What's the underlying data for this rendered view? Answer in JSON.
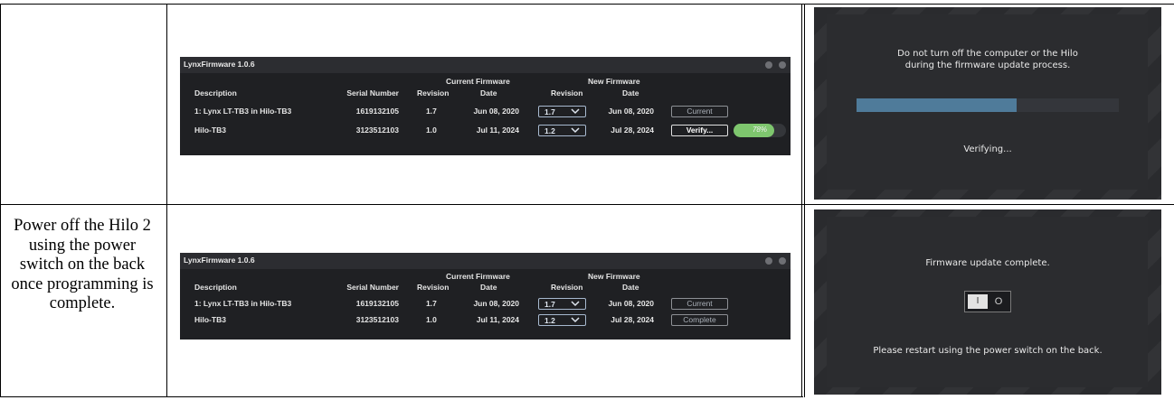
{
  "row1": {
    "step_text": "",
    "app": {
      "title": "LynxFirmware 1.0.6",
      "group_current": "Current Firmware",
      "group_new": "New Firmware",
      "headers": [
        "Description",
        "Serial Number",
        "Revision",
        "Date",
        "Revision",
        "Date"
      ],
      "rows": [
        {
          "description": "1: Lynx LT-TB3 in Hilo-TB3",
          "serial": "1619132105",
          "cur_rev": "1.7",
          "cur_date": "Jun 08, 2020",
          "new_rev": "1.7",
          "new_date": "Jun 08, 2020",
          "action": "Current"
        },
        {
          "description": "Hilo-TB3",
          "serial": "3123512103",
          "cur_rev": "1.0",
          "cur_date": "Jul 11, 2024",
          "new_rev": "1.2",
          "new_date": "Jul 28, 2024",
          "action": "Verify...",
          "progress_label": "78%",
          "progress_fraction": 0.78
        }
      ]
    },
    "dialog": {
      "message": "Do not turn off the computer or the Hilo\nduring the firmware update process.",
      "progress_fraction": 0.61,
      "status": "Verifying..."
    }
  },
  "row2": {
    "step_text": "Power off the Hilo 2 using the power switch on the back once programming is complete.",
    "app": {
      "title": "LynxFirmware 1.0.6",
      "group_current": "Current Firmware",
      "group_new": "New Firmware",
      "headers": [
        "Description",
        "Serial Number",
        "Revision",
        "Date",
        "Revision",
        "Date"
      ],
      "rows": [
        {
          "description": "1: Lynx LT-TB3 in Hilo-TB3",
          "serial": "1619132105",
          "cur_rev": "1.7",
          "cur_date": "Jun 08, 2020",
          "new_rev": "1.7",
          "new_date": "Jun 08, 2020",
          "action": "Current"
        },
        {
          "description": "Hilo-TB3",
          "serial": "3123512103",
          "cur_rev": "1.0",
          "cur_date": "Jul 11, 2024",
          "new_rev": "1.2",
          "new_date": "Jul 28, 2024",
          "action": "Complete"
        }
      ]
    },
    "dialog": {
      "title": "Firmware update complete.",
      "switch_on_label": "I",
      "switch_off_label": "O",
      "instruction": "Please restart using the power switch on the back."
    }
  }
}
